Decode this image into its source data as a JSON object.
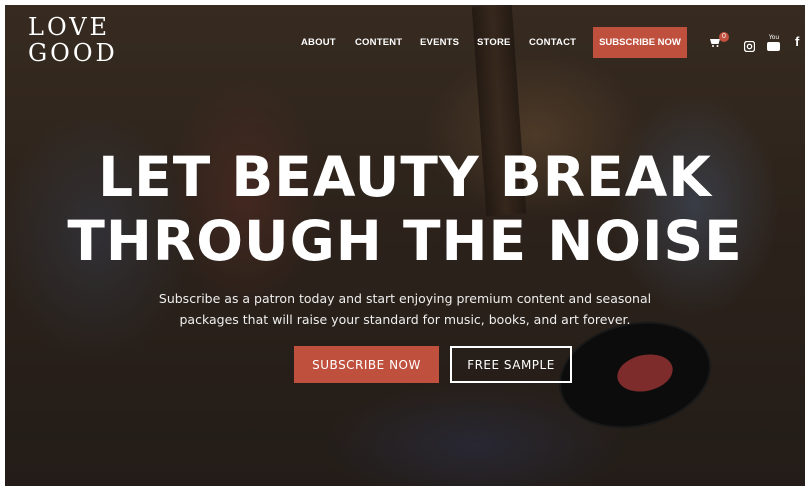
{
  "brand": {
    "logo_line1": "LOVE",
    "logo_line2": "GOOD"
  },
  "nav": {
    "items": [
      {
        "label": "ABOUT"
      },
      {
        "label": "CONTENT"
      },
      {
        "label": "EVENTS"
      },
      {
        "label": "STORE"
      },
      {
        "label": "CONTACT"
      }
    ],
    "cta_label": "SUBSCRIBE NOW",
    "cart_count": "0",
    "icons": [
      "cart-icon",
      "instagram-icon",
      "youtube-icon",
      "facebook-icon"
    ],
    "social": {
      "youtube_text": "You",
      "facebook_text": "f"
    }
  },
  "hero": {
    "headline_line1": "LET BEAUTY BREAK",
    "headline_line2": "THROUGH THE NOISE",
    "subtext_line1": "Subscribe as a patron today and start enjoying premium content and seasonal",
    "subtext_line2": "packages that will raise your standard for music, books, and art forever.",
    "primary_button": "SUBSCRIBE NOW",
    "secondary_button": "FREE SAMPLE"
  },
  "colors": {
    "accent": "#c0503e",
    "text": "#ffffff"
  }
}
